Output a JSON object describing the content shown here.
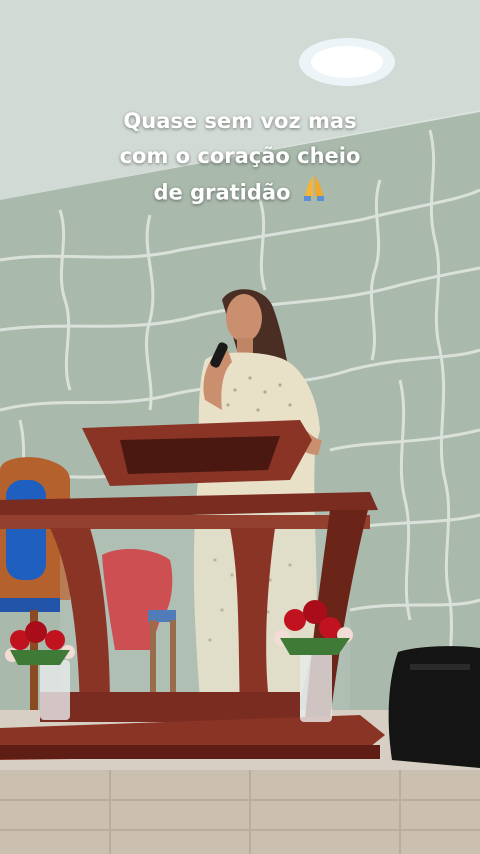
{
  "story": {
    "caption_lines": [
      "Quase sem voz mas",
      "com o coração cheio",
      "de gratidão"
    ],
    "caption_emoji": "praying-hands-emoji"
  },
  "colors": {
    "wall": "#a9b9ac",
    "wall_mortar": "#e3e8e3",
    "ceiling": "#dfe4e0",
    "pulpit_wood": "#8a3426",
    "floor": "#d8cfc4",
    "dress": "#e9e0c8",
    "roses": "#c1121f",
    "chair_seat": "#1f5fbf",
    "speaker": "#141414"
  }
}
